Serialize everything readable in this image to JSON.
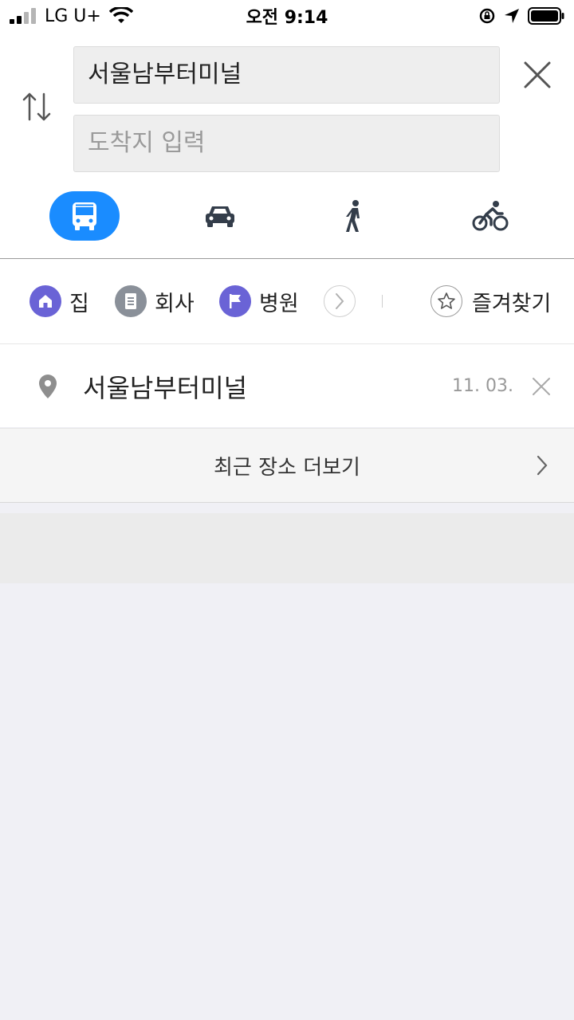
{
  "status_bar": {
    "carrier": "LG U+",
    "time": "오전 9:14"
  },
  "route": {
    "origin_value": "서울남부터미널",
    "destination_placeholder": "도착지 입력"
  },
  "modes": [
    {
      "name": "bus",
      "icon": "bus-icon",
      "selected": true
    },
    {
      "name": "car",
      "icon": "car-icon",
      "selected": false
    },
    {
      "name": "walk",
      "icon": "walk-icon",
      "selected": false
    },
    {
      "name": "bike",
      "icon": "bike-icon",
      "selected": false
    }
  ],
  "shortcuts": {
    "items": [
      {
        "label": "집",
        "icon": "home-icon"
      },
      {
        "label": "회사",
        "icon": "document-icon"
      },
      {
        "label": "병원",
        "icon": "flag-icon"
      }
    ],
    "favorites_label": "즐겨찾기"
  },
  "recent": {
    "items": [
      {
        "name": "서울남부터미널",
        "date": "11. 03."
      }
    ],
    "more_label": "최근 장소 더보기"
  },
  "colors": {
    "accent": "#1a8cff",
    "chip_purple": "#6a63d6",
    "chip_gray": "#8a9099",
    "icon_dark": "#333d4a"
  }
}
